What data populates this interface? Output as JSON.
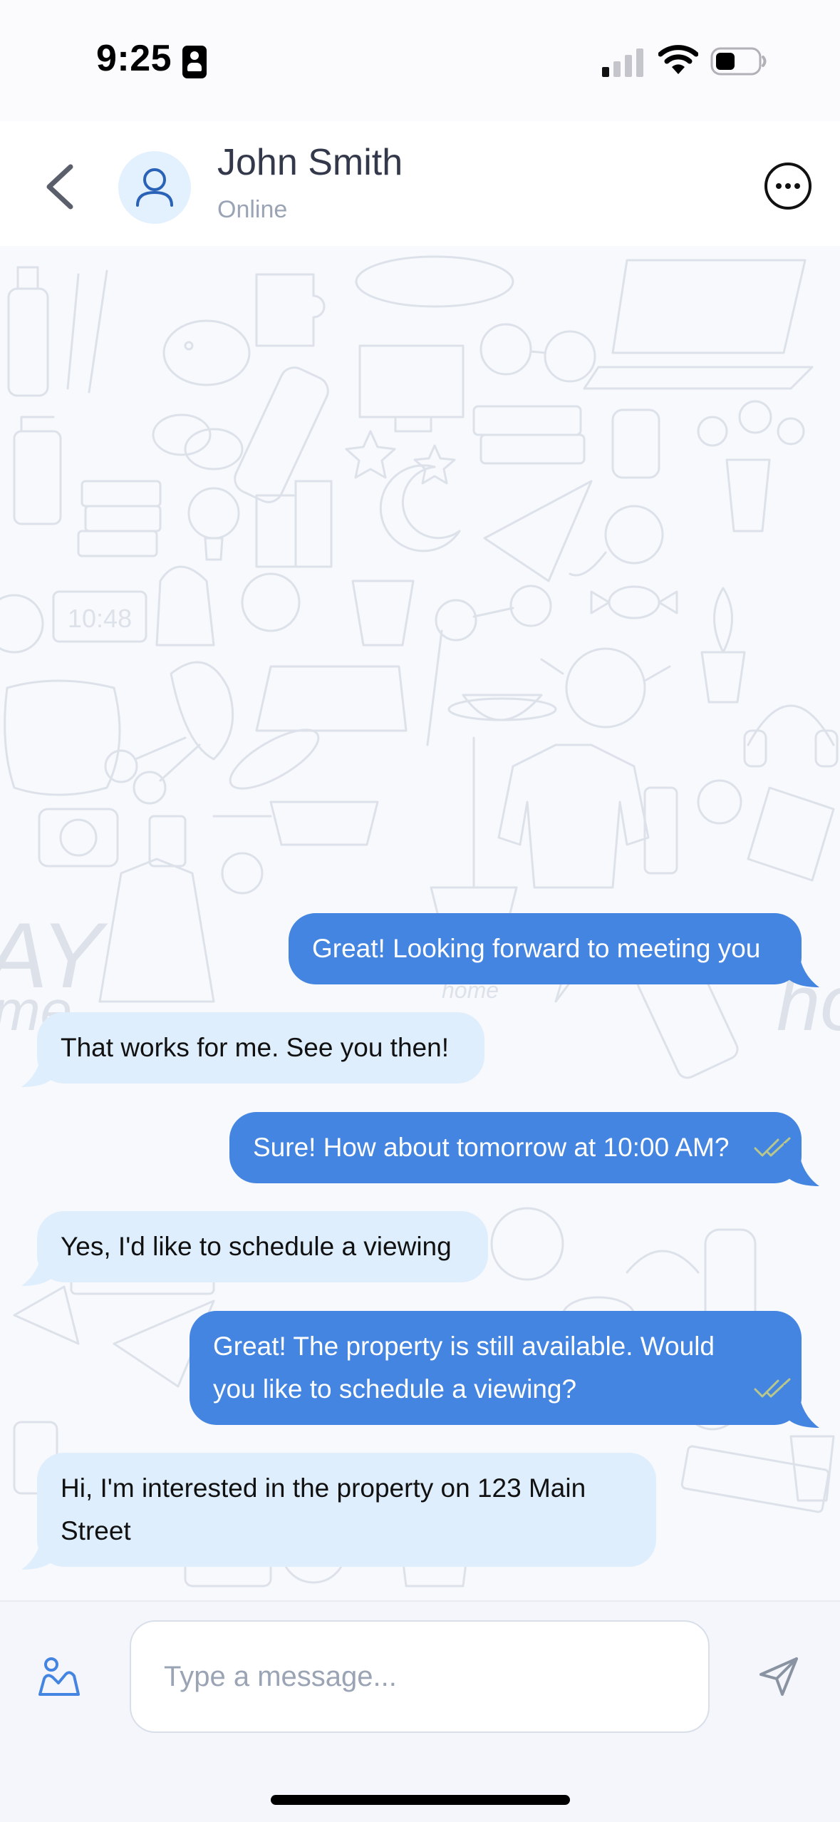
{
  "status_bar": {
    "time": "9:25",
    "icons": [
      "signal-icon",
      "wifi-icon",
      "battery-icon"
    ]
  },
  "header": {
    "contact_name": "John Smith",
    "contact_status": "Online",
    "back_icon": "chevron-left-icon",
    "avatar_icon": "user-icon",
    "more_icon": "more-horizontal-icon"
  },
  "messages": [
    {
      "direction": "outgoing",
      "text": "Great! Looking forward to meeting you",
      "read": false
    },
    {
      "direction": "incoming",
      "text": "That works for me. See you then!"
    },
    {
      "direction": "outgoing",
      "text": "Sure! How about tomorrow at 10:00 AM?",
      "read": true
    },
    {
      "direction": "incoming",
      "text": "Yes, I'd like to schedule a viewing"
    },
    {
      "direction": "outgoing",
      "text": "Great! The property is still available. Would\nyou like to schedule a viewing?",
      "read": true
    },
    {
      "direction": "incoming",
      "text": "Hi, I'm interested in the property on 123 Main\nStreet"
    }
  ],
  "composer": {
    "placeholder": "Type a message...",
    "value": "",
    "attach_icon": "image-icon",
    "send_icon": "send-icon"
  },
  "colors": {
    "outgoing_bubble": "#4485e1",
    "incoming_bubble": "#dfeefd",
    "read_check": "#b9c78a",
    "accent": "#4485e1"
  }
}
